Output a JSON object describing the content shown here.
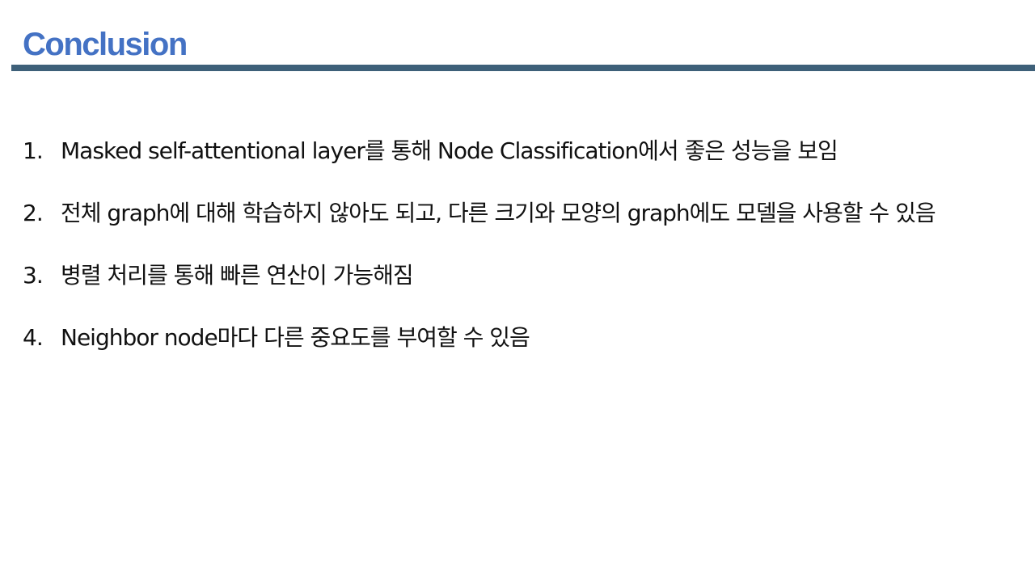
{
  "slide": {
    "title": "Conclusion",
    "title_color": "#4472c4",
    "rule_color": "#3e6079",
    "items": [
      {
        "number": "1.",
        "text": "Masked self-attentional layer를 통해 Node Classification에서 좋은 성능을 보임"
      },
      {
        "number": "2.",
        "text": "전체 graph에 대해 학습하지 않아도 되고, 다른 크기와 모양의 graph에도 모델을 사용할 수 있음"
      },
      {
        "number": "3.",
        "text": "병렬 처리를 통해 빠른 연산이 가능해짐"
      },
      {
        "number": "4.",
        "text": "Neighbor node마다 다른 중요도를 부여할 수 있음"
      }
    ]
  }
}
